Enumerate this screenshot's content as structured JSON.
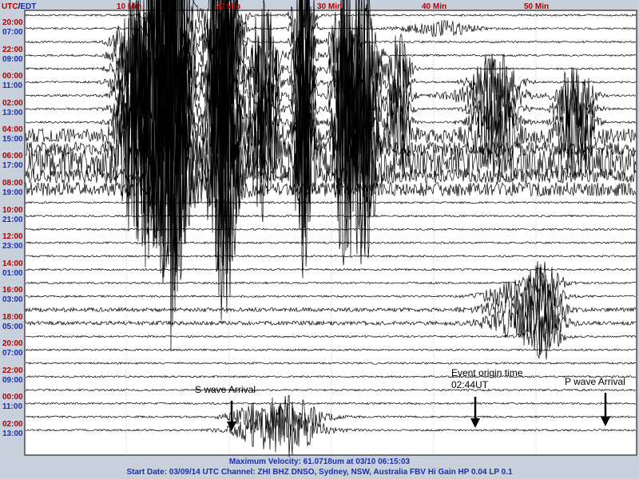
{
  "header": {
    "utc": "UTC",
    "slash": "/",
    "edt": "EDT"
  },
  "minute_labels": [
    "10 Min",
    "20 Min",
    "30 Min",
    "40 Min",
    "50 Min"
  ],
  "time_labels": [
    {
      "utc": "20:00",
      "edt": "07:00"
    },
    {
      "utc": "22:00",
      "edt": "09:00"
    },
    {
      "utc": "00:00",
      "edt": "11:00"
    },
    {
      "utc": "02:00",
      "edt": "13:00"
    },
    {
      "utc": "04:00",
      "edt": "15:00"
    },
    {
      "utc": "06:00",
      "edt": "17:00"
    },
    {
      "utc": "08:00",
      "edt": "19:00"
    },
    {
      "utc": "10:00",
      "edt": "21:00"
    },
    {
      "utc": "12:00",
      "edt": "23:00"
    },
    {
      "utc": "14:00",
      "edt": "01:00"
    },
    {
      "utc": "16:00",
      "edt": "03:00"
    },
    {
      "utc": "18:00",
      "edt": "05:00"
    },
    {
      "utc": "20:00",
      "edt": "07:00"
    },
    {
      "utc": "22:00",
      "edt": "09:00"
    },
    {
      "utc": "00:00",
      "edt": "11:00"
    },
    {
      "utc": "02:00",
      "edt": "13:00"
    }
  ],
  "annotations": {
    "s_wave": "S wave Arrival",
    "event_origin_line1": "Event origin time",
    "event_origin_line2": "02:44UT",
    "p_wave": "P wave Arrival"
  },
  "footer": {
    "line1": "Maximum Velocity: 61.0718um at 03/10 06:15:03",
    "line2": "Start Date: 03/09/14 UTC Channel: ZHI  BHZ  DNSO, Sydney, NSW, Australia  FBV Hi Gain HP 0.04 LP 0.1"
  },
  "colors": {
    "background": "#c8d0dc",
    "plot_bg": "#ffffff",
    "trace": "#000000",
    "utc_label": "#b00000",
    "edt_label": "#1a2fb0"
  }
}
